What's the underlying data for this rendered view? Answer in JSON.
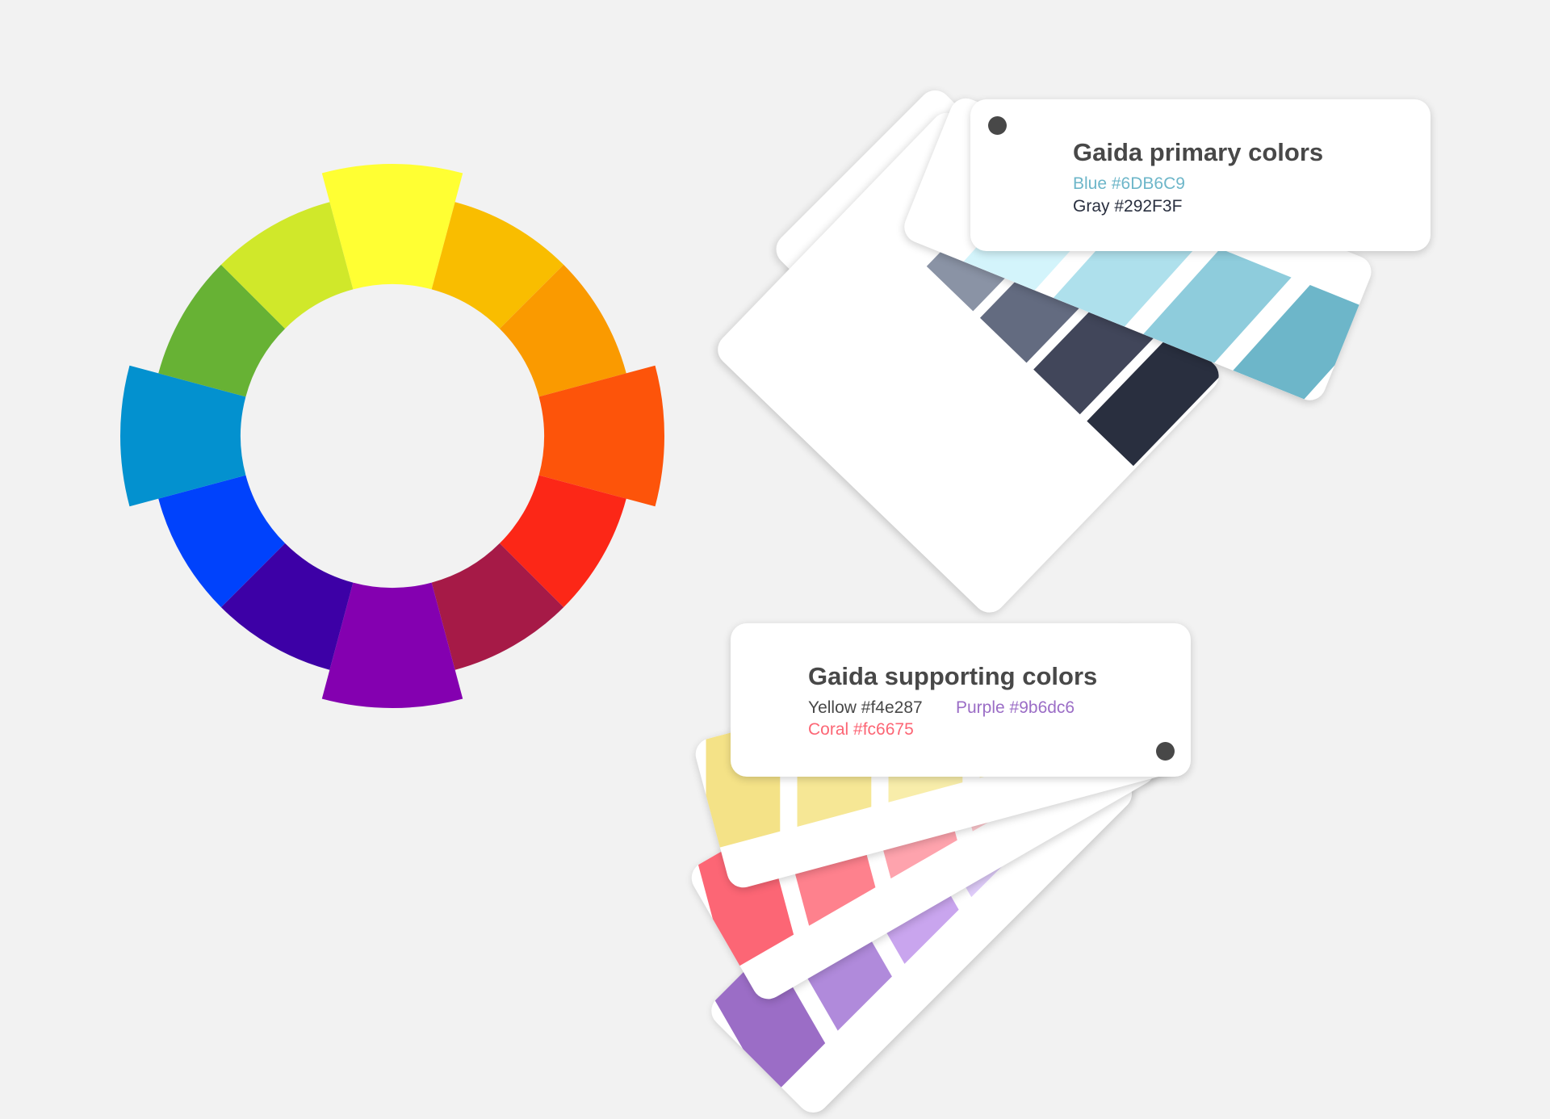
{
  "color_wheel": {
    "segments": [
      {
        "color": "#FFFF33",
        "pop": true
      },
      {
        "color": "#F9BD00",
        "pop": false
      },
      {
        "color": "#FA9A00",
        "pop": false
      },
      {
        "color": "#FD540A",
        "pop": true
      },
      {
        "color": "#FC2717",
        "pop": false
      },
      {
        "color": "#A61A47",
        "pop": false
      },
      {
        "color": "#8400B0",
        "pop": true
      },
      {
        "color": "#3D00A6",
        "pop": false
      },
      {
        "color": "#0042FC",
        "pop": false
      },
      {
        "color": "#0391CF",
        "pop": true
      },
      {
        "color": "#67B234",
        "pop": false
      },
      {
        "color": "#D0E82A",
        "pop": false
      }
    ]
  },
  "primary_swatch": {
    "title": "Gaida primary colors",
    "lines": [
      {
        "text": "Blue #6DB6C9",
        "color": "#6DB6C9"
      },
      {
        "text": "Gray #292F3F",
        "color": "#292F3F"
      }
    ],
    "blue_strip": [
      "#D3F4FB",
      "#AEE0EC",
      "#8ECCDC",
      "#6DB6C9"
    ],
    "gray_strip": [
      "#8A93A5",
      "#636B80",
      "#41465A",
      "#292F3F"
    ]
  },
  "supporting_swatch": {
    "title": "Gaida supporting colors",
    "lines": [
      {
        "text": "Yellow #f4e287",
        "color": "#484848"
      },
      {
        "text": "Purple #9b6dc6",
        "color": "#9B6DC6"
      },
      {
        "text": "Coral #fc6675",
        "color": "#FC6675"
      }
    ],
    "purple_strip": [
      "#9B6DC6",
      "#B08ADB",
      "#C9A5EE",
      "#DFCCFA"
    ],
    "coral_strip": [
      "#FC6675",
      "#FE818D",
      "#FEA3AD",
      "#FFC8CE"
    ],
    "yellow_strip": [
      "#F4E287",
      "#F6E795",
      "#F8EDAA",
      "#FAF3C6"
    ]
  }
}
